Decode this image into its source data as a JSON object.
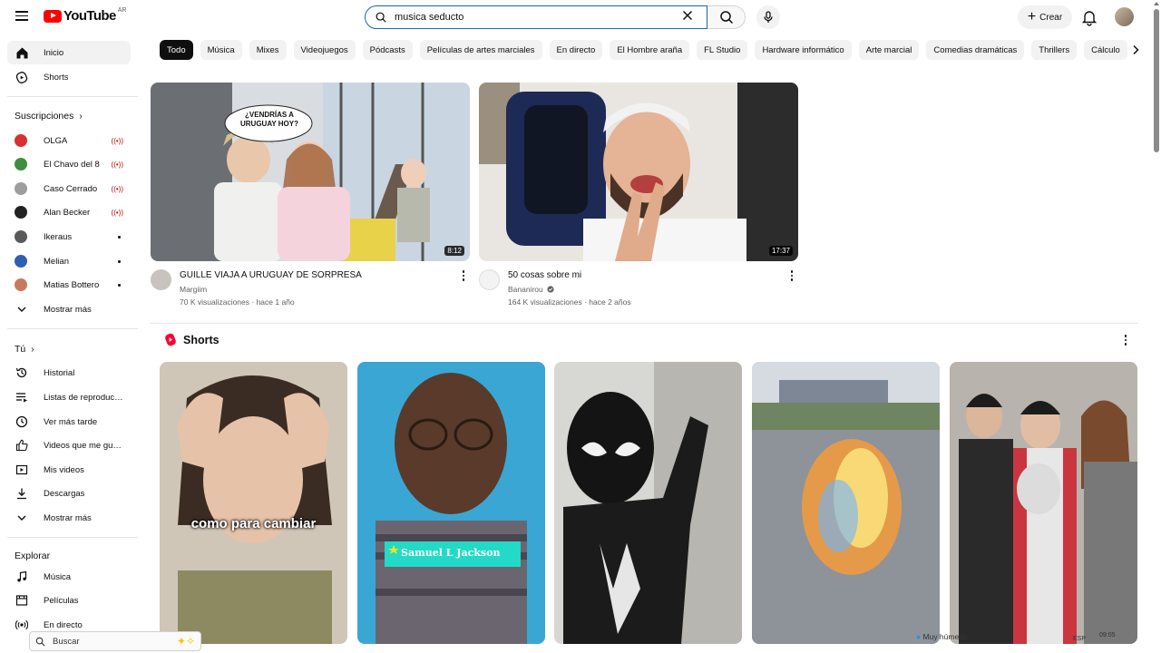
{
  "header": {
    "logo_text": "YouTube",
    "country_code": "AR",
    "search_value": "musica seducto",
    "create_label": "Crear"
  },
  "sidebar": {
    "main": [
      {
        "label": "Inicio",
        "icon": "home-icon",
        "active": true
      },
      {
        "label": "Shorts",
        "icon": "shorts-icon"
      }
    ],
    "subscriptions_heading": "Suscripciones",
    "subscriptions": [
      {
        "label": "OLGA",
        "status": "live",
        "color": "#d8312f"
      },
      {
        "label": "El Chavo del 8",
        "status": "live",
        "color": "#3f8d3f"
      },
      {
        "label": "Caso Cerrado",
        "status": "live",
        "color": "#9e9e9e"
      },
      {
        "label": "Alan Becker",
        "status": "live",
        "color": "#222222"
      },
      {
        "label": "Ikeraus",
        "status": "new",
        "color": "#5a5a5a"
      },
      {
        "label": "Melian",
        "status": "new",
        "color": "#2f5fb5"
      },
      {
        "label": "Matias Bottero",
        "status": "new",
        "color": "#c87b5c"
      }
    ],
    "show_more_1": "Mostrar más",
    "you_heading": "Tú",
    "you_items": [
      {
        "label": "Historial",
        "icon": "history-icon"
      },
      {
        "label": "Listas de reproducc...",
        "icon": "playlists-icon"
      },
      {
        "label": "Ver más tarde",
        "icon": "watch-later-icon"
      },
      {
        "label": "Videos que me gus...",
        "icon": "like-icon"
      },
      {
        "label": "Mis videos",
        "icon": "my-videos-icon"
      },
      {
        "label": "Descargas",
        "icon": "download-icon"
      }
    ],
    "show_more_2": "Mostrar más",
    "explore_heading": "Explorar",
    "explore_items": [
      {
        "label": "Música",
        "icon": "music-icon"
      },
      {
        "label": "Películas",
        "icon": "movies-icon"
      },
      {
        "label": "En directo",
        "icon": "live-icon"
      }
    ]
  },
  "chips": [
    "Todo",
    "Música",
    "Mixes",
    "Videojuegos",
    "Pódcasts",
    "Películas de artes marciales",
    "En directo",
    "El Hombre araña",
    "FL Studio",
    "Hardware informático",
    "Arte marcial",
    "Comedias dramáticas",
    "Thrillers",
    "Cálculo"
  ],
  "videos": [
    {
      "title": "GUILLE VIAJA A URUGUAY DE SORPRESA",
      "channel": "Margiim",
      "meta": "70 K visualizaciones · hace 1 año",
      "duration": "8:12",
      "thumb_text_1": "¿VENDRÍAS A",
      "thumb_text_2": "URUGUAY HOY?"
    },
    {
      "title": "50 cosas sobre mi",
      "channel": "Bananirou",
      "meta": "164 K visualizaciones · hace 2 años",
      "duration": "17:37"
    }
  ],
  "shorts": {
    "heading": "Shorts",
    "items": [
      {
        "caption": "como para cambiar"
      },
      {
        "caption": "Samuel L Jackson"
      },
      {
        "caption": ""
      },
      {
        "caption": ""
      },
      {
        "caption": ""
      }
    ]
  },
  "taskbar": {
    "search_label": "Buscar",
    "weather": "Muy húmedo",
    "lang": "ESP",
    "time": "09:05"
  }
}
